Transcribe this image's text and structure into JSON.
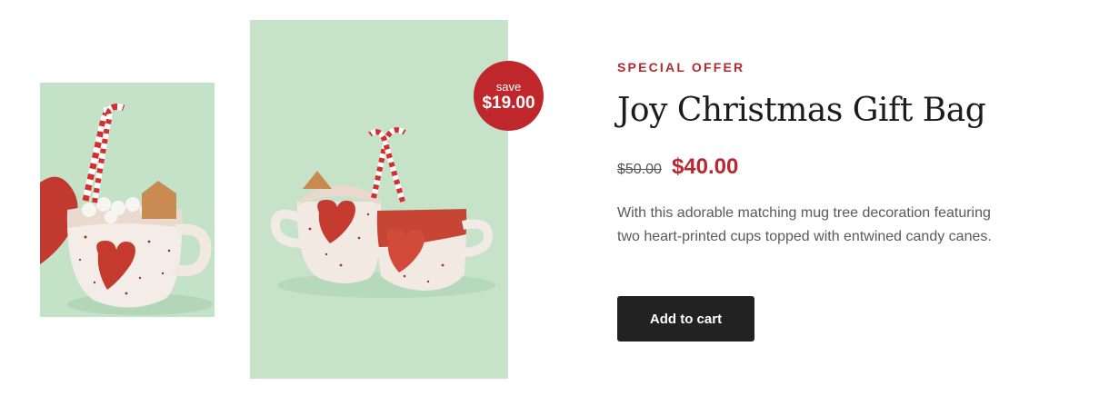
{
  "gallery": {
    "badge": {
      "label": "save",
      "amount": "$19.00"
    }
  },
  "product": {
    "eyebrow": "SPECIAL OFFER",
    "title": "Joy Christmas Gift Bag",
    "old_price": "$50.00",
    "new_price": "$40.00",
    "description": "With this adorable matching mug tree decoration featuring two heart-printed cups topped with entwined candy canes.",
    "add_to_cart_label": "Add to cart"
  },
  "colors": {
    "accent": "#b8282e",
    "badge": "#c0272d",
    "button": "#222222",
    "photo_background": "#c6e3c9"
  }
}
